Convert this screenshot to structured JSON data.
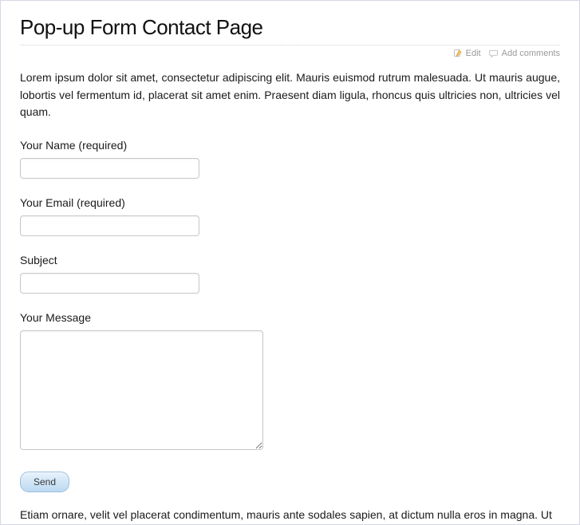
{
  "page": {
    "title": "Pop-up Form Contact Page",
    "intro": "Lorem ipsum dolor sit amet, consectetur adipiscing elit. Mauris euismod rutrum malesuada. Ut mauris augue, lobortis vel fermentum id, placerat sit amet enim. Praesent diam ligula, rhoncus quis ultricies non, ultricies vel quam.",
    "outro": "Etiam ornare, velit vel placerat condimentum, mauris ante sodales sapien, at dictum nulla eros in magna. Ut"
  },
  "meta": {
    "edit_label": "Edit",
    "comments_label": "Add comments"
  },
  "form": {
    "name": {
      "label": "Your Name (required)",
      "value": ""
    },
    "email": {
      "label": "Your Email (required)",
      "value": ""
    },
    "subject": {
      "label": "Subject",
      "value": ""
    },
    "message": {
      "label": "Your Message",
      "value": ""
    },
    "submit_label": "Send"
  }
}
